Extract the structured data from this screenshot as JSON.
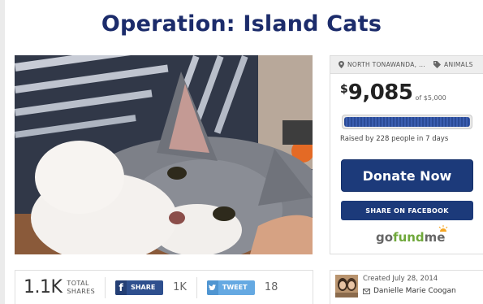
{
  "campaign": {
    "title": "Operation: Island Cats",
    "location": "NORTH TONAWANDA, ...",
    "category": "ANIMALS"
  },
  "funding": {
    "currency_symbol": "$",
    "raised": "9,085",
    "goal_text": "of $5,000",
    "progress_fraction": 1.0,
    "raised_by_prefix": "Raised by ",
    "people_count": "228",
    "people_suffix": " people in ",
    "days": "7 days"
  },
  "actions": {
    "donate_label": "Donate Now",
    "share_facebook_label": "SHARE ON FACEBOOK"
  },
  "brand": {
    "go": "go",
    "fund": "fund",
    "me": "me"
  },
  "shares": {
    "total": "1.1K",
    "total_label_1": "TOTAL",
    "total_label_2": "SHARES",
    "facebook_label": "SHARE",
    "facebook_count": "1K",
    "tweet_label": "TWEET",
    "tweet_count": "18"
  },
  "creator": {
    "created_text": "Created July 28, 2014",
    "name": "Danielle Marie Coogan"
  },
  "colors": {
    "title": "#1c2c6b",
    "primary_button": "#1c3a7a",
    "facebook": "#2e4f8e",
    "twitter": "#65a9e2",
    "gofundme_green": "#6fa83b"
  },
  "icons": {
    "location": "map-pin-icon",
    "category": "tag-icon",
    "facebook": "facebook-icon",
    "twitter": "twitter-bird-icon",
    "email": "envelope-icon",
    "logo_sun": "sun-icon"
  }
}
